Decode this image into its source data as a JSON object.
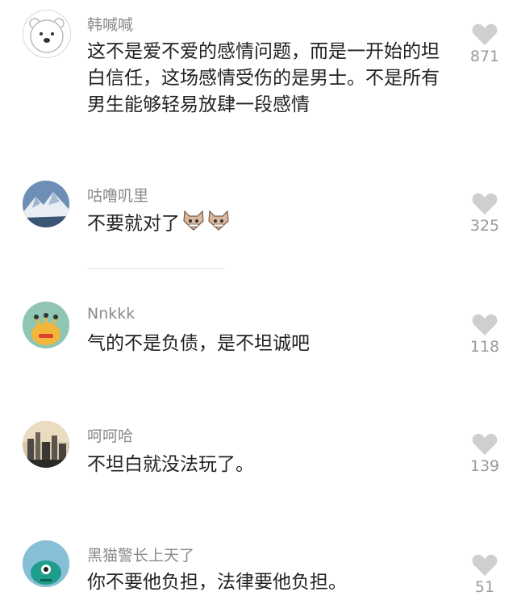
{
  "comments": [
    {
      "username": "韩喊喊",
      "avatar": "polar-bear-avatar",
      "text": "这不是爱不爱的感情问题，而是一开始的坦白信任，这场感情受伤的是男士。不是所有男生能够轻易放肆一段感情",
      "likes": "871"
    },
    {
      "username": "咕噜叽里",
      "avatar": "mountain-avatar",
      "text": "不要就对了",
      "emoji": [
        "cat-face-icon",
        "cat-face-icon"
      ],
      "likes": "325"
    },
    {
      "username": "Nnkkk",
      "avatar": "monster-avatar",
      "text": "气的不是负债，是不坦诚吧",
      "likes": "118"
    },
    {
      "username": "呵呵哈",
      "avatar": "city-avatar",
      "text": "不坦白就没法玩了。",
      "likes": "139"
    },
    {
      "username": "黑猫警长上天了",
      "avatar": "blob-avatar",
      "text": "你不要他负担，法律要他负担。",
      "likes": "51"
    }
  ],
  "colors": {
    "background": "#ffffff",
    "username": "#8a8a8a",
    "text": "#222222",
    "heart": "#cfcfcf",
    "count": "#9a9a9a"
  }
}
